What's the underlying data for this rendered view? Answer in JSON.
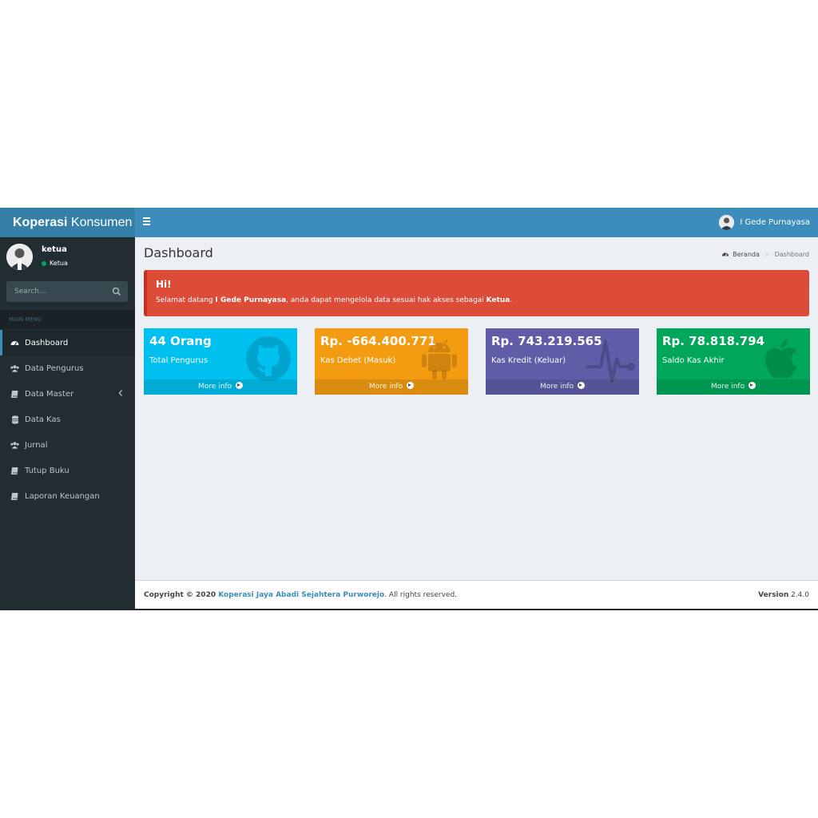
{
  "header": {
    "logo_bold": "Koperasi",
    "logo_rest": " Konsumen",
    "user_name": "I Gede Purnayasa"
  },
  "sidebar": {
    "user": {
      "name": "ketua",
      "status": "Ketua",
      "status_color": "#00a65a"
    },
    "search": {
      "placeholder": "Search..."
    },
    "menu_header": "MAIN MENU",
    "items": [
      {
        "label": "Dashboard",
        "icon": "dashboard-icon",
        "active": true
      },
      {
        "label": "Data Pengurus",
        "icon": "users-icon"
      },
      {
        "label": "Data Master",
        "icon": "book-icon",
        "has_submenu": true
      },
      {
        "label": "Data Kas",
        "icon": "database-icon"
      },
      {
        "label": "Jurnal",
        "icon": "users-icon"
      },
      {
        "label": "Tutup Buku",
        "icon": "book-icon"
      },
      {
        "label": "Laporan Keuangan",
        "icon": "book-icon"
      }
    ]
  },
  "main": {
    "title": "Dashboard",
    "breadcrumb": {
      "home": "Beranda",
      "current": "Dashboard"
    },
    "alert": {
      "title": "Hi!",
      "text_1": "Selamat datang ",
      "user": "I Gede Purnayasa",
      "text_2": ", anda dapat mengelola data sesuai hak akses sebagai ",
      "role": "Ketua",
      "text_3": ".",
      "color": "#dd4b39"
    },
    "boxes": [
      {
        "value": "44 Orang",
        "label": "Total Pengurus",
        "footer": "More info",
        "color": "#00c0ef",
        "icon": "github-icon"
      },
      {
        "value": "Rp. -664.400.771",
        "label": "Kas Debet (Masuk)",
        "footer": "More info",
        "color": "#f39c12",
        "icon": "android-icon"
      },
      {
        "value": "Rp. 743.219.565",
        "label": "Kas Kredit (Keluar)",
        "footer": "More info",
        "color": "#605ca8",
        "icon": "heartbeat-icon"
      },
      {
        "value": "Rp. 78.818.794",
        "label": "Saldo Kas Akhir",
        "footer": "More info",
        "color": "#00a65a",
        "icon": "apple-icon"
      }
    ]
  },
  "footer": {
    "copyright_prefix": "Copyright © 2020 ",
    "org": "Koperasi Jaya Abadi Sejahtera Purworejo",
    "suffix": ". All rights reserved.",
    "version_label": "Version",
    "version_value": " 2.4.0"
  }
}
